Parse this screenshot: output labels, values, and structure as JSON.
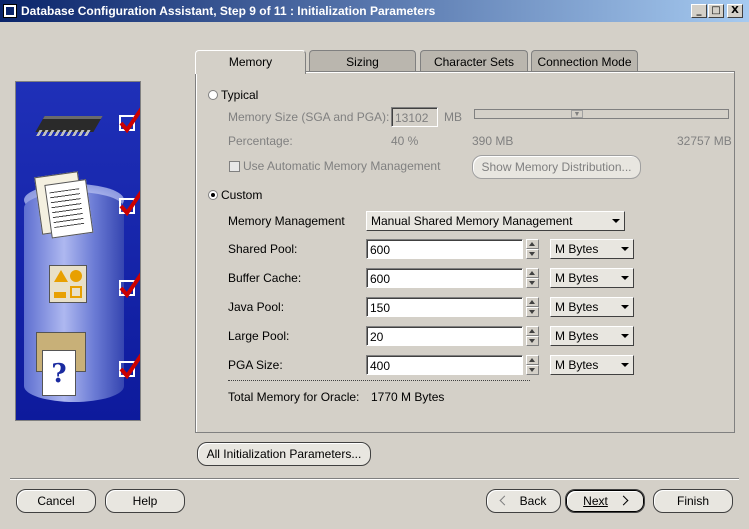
{
  "window": {
    "title": "Database Configuration Assistant, Step 9 of 11 : Initialization Parameters",
    "buttons": {
      "minimize": "_",
      "maximize": "□",
      "close": "X"
    }
  },
  "tabs": [
    {
      "label": "Memory",
      "active": true
    },
    {
      "label": "Sizing",
      "active": false
    },
    {
      "label": "Character Sets",
      "active": false
    },
    {
      "label": "Connection Mode",
      "active": false
    }
  ],
  "typical": {
    "label": "Typical",
    "selected": false,
    "memory_size_label": "Memory Size (SGA and PGA):",
    "memory_size_value": "13102",
    "memory_size_unit": "MB",
    "percentage_label": "Percentage:",
    "percentage_value": "40 %",
    "slider_min": "390 MB",
    "slider_max": "32757 MB",
    "slider_fraction": 0.4,
    "auto_mem_label": "Use Automatic Memory Management",
    "auto_mem_checked": false,
    "show_distribution_button": "Show Memory Distribution..."
  },
  "custom": {
    "label": "Custom",
    "selected": true,
    "memory_management_label": "Memory Management",
    "memory_management_value": "Manual Shared Memory Management",
    "rows": [
      {
        "label": "Shared Pool:",
        "value": "600",
        "unit": "M Bytes"
      },
      {
        "label": "Buffer Cache:",
        "value": "600",
        "unit": "M Bytes"
      },
      {
        "label": "Java Pool:",
        "value": "150",
        "unit": "M Bytes"
      },
      {
        "label": "Large Pool:",
        "value": "20",
        "unit": "M Bytes"
      },
      {
        "label": "PGA Size:",
        "value": "400",
        "unit": "M Bytes"
      }
    ],
    "total_label": "Total Memory for Oracle:",
    "total_value": "1770 M Bytes"
  },
  "all_params_button": "All Initialization Parameters...",
  "footer": {
    "cancel": "Cancel",
    "help": "Help",
    "back": "Back",
    "next": "Next",
    "finish": "Finish"
  },
  "colors": {
    "accent": "#0a246a",
    "check": "#cc0000",
    "side_panel": "#1428b0"
  }
}
